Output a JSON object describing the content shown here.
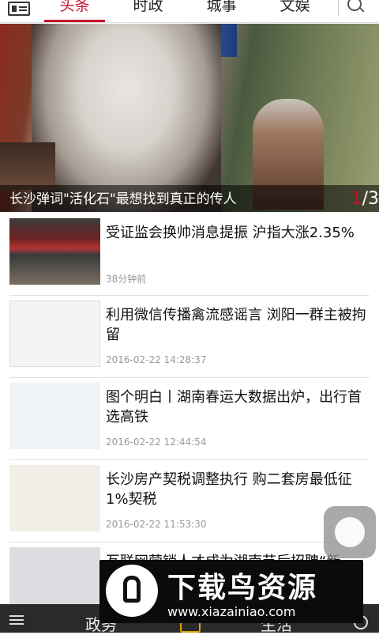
{
  "tabs": [
    "头条",
    "时政",
    "城事",
    "文娱"
  ],
  "hero": {
    "caption": "长沙弹词\"活化石\"最想找到真正的传人",
    "page_current": "1",
    "page_total": "/3"
  },
  "news": [
    {
      "title": "受证监会换帅消息提振 沪指大涨2.35%",
      "time": "38分钟前"
    },
    {
      "title": "利用微信传播禽流感谣言 浏阳一群主被拘留",
      "time": "2016-02-22 14:28:37"
    },
    {
      "title": "图个明白丨湖南春运大数据出炉，出行首选高铁",
      "time": "2016-02-22 12:44:54"
    },
    {
      "title": "长沙房产契税调整执行 购二套房最低征1%契税",
      "time": "2016-02-22 11:53:30"
    },
    {
      "title": "互联网营销人才成为湖南节后招聘“新",
      "time": ""
    }
  ],
  "bottom_nav": {
    "left_label": "政务",
    "right_label": "生活"
  },
  "watermark": {
    "title": "下载鸟资源",
    "url": "www.xiazainiao.com"
  },
  "colors": {
    "accent": "#c8102e"
  }
}
